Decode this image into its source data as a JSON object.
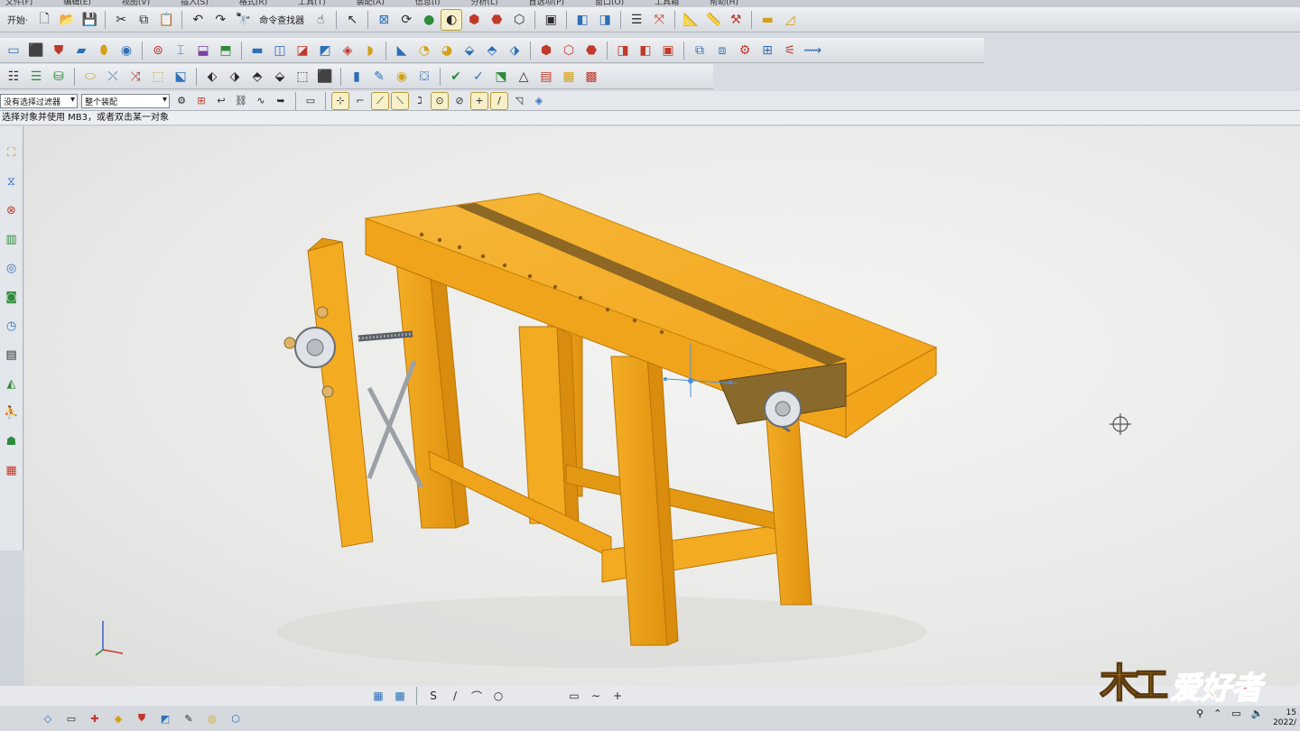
{
  "menu": [
    "文件(F)",
    "编辑(E)",
    "视图(V)",
    "插入(S)",
    "格式(R)",
    "工具(T)",
    "装配(A)",
    "信息(I)",
    "分析(L)",
    "首选项(P)",
    "窗口(O)",
    "工具箱",
    "帮助(H)"
  ],
  "toolbar": {
    "start_label": "开始·",
    "command_finder_label": "命令查找器"
  },
  "selection": {
    "filter_value": "没有选择过滤器",
    "scope_value": "整个装配"
  },
  "status": {
    "prompt": "选择对象并使用 MB3，或者双击某一对象"
  },
  "tray": {
    "time": "15",
    "date": "2022/"
  },
  "watermark": {
    "text": "爱好者",
    "glyph": "木工"
  },
  "colors": {
    "wood": "#f2a91c",
    "wood_dark": "#c97f0a",
    "wood_shadow": "#9a5e08",
    "slot": "#7a5a22",
    "chop": "#8a6a2c",
    "handwheel": "#c8ccd2",
    "dimension": "#4a8fe0"
  },
  "icons": {
    "side_palette": [
      "assembly-navigator-icon",
      "constraint-navigator-icon",
      "part-navigator-icon",
      "reuse-library-icon",
      "web-browser-icon",
      "history-icon",
      "system-materials-icon",
      "process-studio-icon",
      "manufacturing-wizard-icon",
      "roles-icon",
      "system-scenes-icon"
    ]
  }
}
